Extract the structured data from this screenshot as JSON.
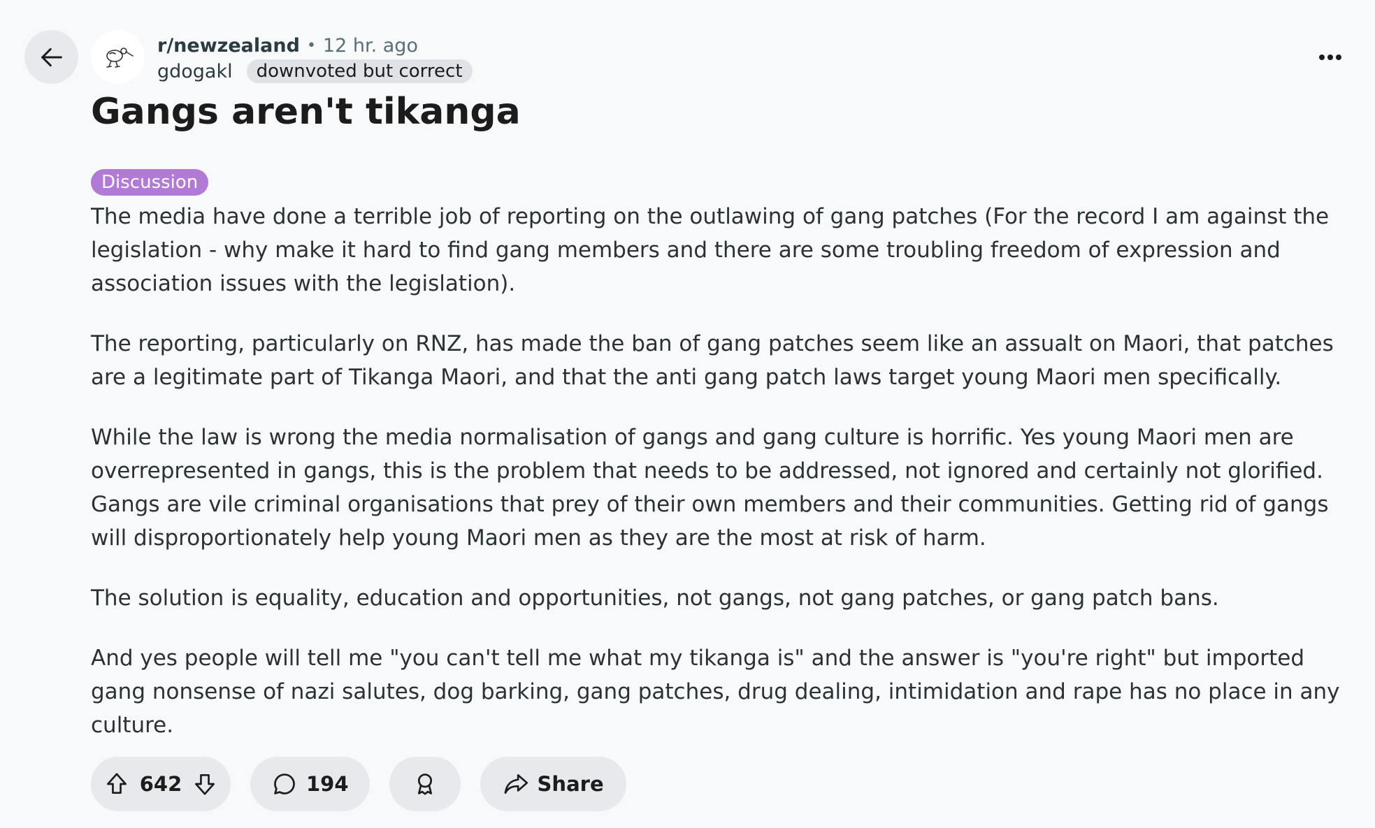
{
  "header": {
    "back_icon": "arrow-left-icon",
    "avatar_icon": "kiwi-bird-icon",
    "subreddit": "r/newzealand",
    "separator": "•",
    "time_ago": "12 hr. ago",
    "author": "gdogakl",
    "user_flair": "downvoted but correct",
    "more_icon": "ellipsis-icon"
  },
  "post": {
    "title": "Gangs aren't tikanga",
    "flair": "Discussion",
    "flair_color": "#b07ad6",
    "paragraphs": [
      "The media have done a terrible job of reporting on the outlawing of gang patches (For the record I am against the legislation - why make it hard to find gang members and there are some troubling freedom of expression and association issues with the legislation).",
      "The reporting, particularly on RNZ, has made the ban of gang patches seem like an assualt on Maori, that patches are a legitimate part of Tikanga Maori, and that the anti gang patch laws target young Maori men specifically.",
      "While the law is wrong the media normalisation of gangs and gang culture is horrific. Yes young Maori men are overrepresented in gangs, this is the problem that needs to be addressed, not ignored and certainly not glorified. Gangs are vile criminal organisations that prey of their own members and their communities. Getting rid of gangs will disproportionately help young Maori men as they are the most at risk of harm.",
      "The solution is equality, education and opportunities, not gangs, not gang patches, or gang patch bans.",
      "And yes people will tell me \"you can't tell me what my tikanga is\" and the answer is \"you're right\" but imported gang nonsense of nazi salutes, dog barking, gang patches, drug dealing, intimidation and rape has no place in any culture."
    ]
  },
  "actions": {
    "upvote_icon": "arrow-up-icon",
    "vote_count": "642",
    "downvote_icon": "arrow-down-icon",
    "comment_icon": "speech-bubble-icon",
    "comment_count": "194",
    "award_icon": "award-ribbon-icon",
    "share_icon": "share-arrow-icon",
    "share_label": "Share"
  }
}
